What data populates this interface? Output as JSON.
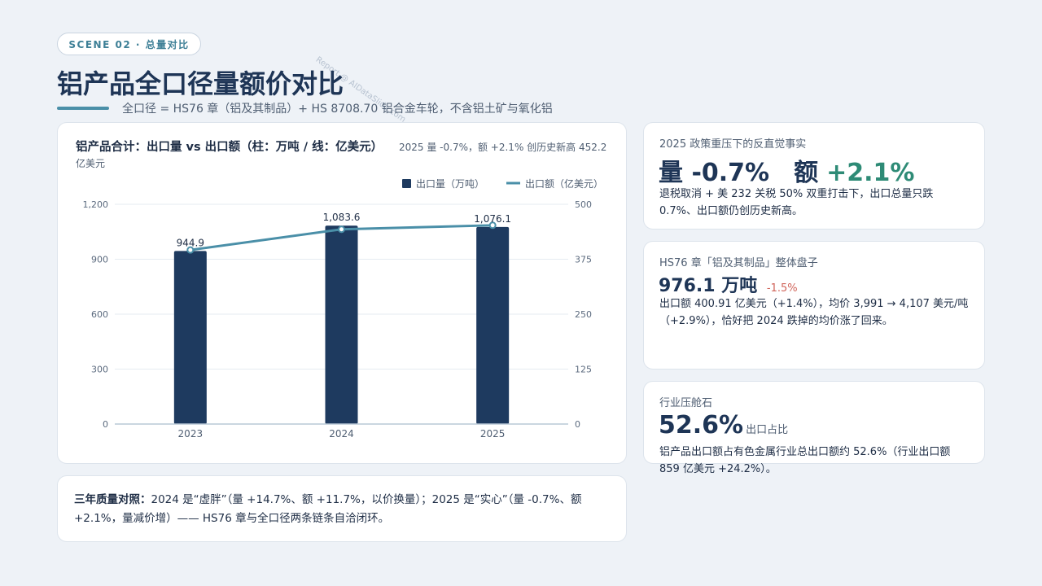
{
  "scene_tag": "SCENE 02 · 总量对比",
  "watermark": "Report @ AIDataSlide.com",
  "title": "铝产品全口径量额价对比",
  "subtitle": "全口径 = HS76 章（铝及其制品）+ HS 8708.70 铝合金车轮，不含铝土矿与氧化铝",
  "chart_data": {
    "type": "bar",
    "title": "铝产品合计：出口量 vs 出口额（柱：万吨 / 线：亿美元）",
    "subtitle": "2025 量 -0.7%，额 +2.1% 创历史新高 452.2 亿美元",
    "categories": [
      "2023",
      "2024",
      "2025"
    ],
    "series": [
      {
        "name": "出口量（万吨）",
        "type": "bar",
        "axis": "left",
        "values": [
          944.9,
          1083.6,
          1076.1
        ],
        "color": "#1e3a5f"
      },
      {
        "name": "出口额（亿美元）",
        "type": "line",
        "axis": "right",
        "values": [
          396.0,
          443.0,
          452.2
        ],
        "color": "#4a8fa8"
      }
    ],
    "data_labels": [
      "944.9",
      "1,083.6",
      "1,076.1"
    ],
    "y_left": {
      "ticks": [
        "0",
        "300",
        "600",
        "900",
        "1,200"
      ],
      "ylim": [
        0,
        1200
      ]
    },
    "y_right": {
      "ticks": [
        "0",
        "125",
        "250",
        "375",
        "500"
      ],
      "ylim": [
        0,
        500
      ]
    },
    "legend_position": "top-right",
    "grid": true
  },
  "note": {
    "label": "三年质量对照：",
    "text": "2024 是“虚胖”（量 +14.7%、额 +11.7%，以价换量）；2025 是“实心”（量 -0.7%、额 +2.1%，量减价增）—— HS76 章与全口径两条链条自洽闭环。"
  },
  "cards": [
    {
      "label": "2025 政策重压下的反直觉事实",
      "big1": "量 -0.7%",
      "big2": "额",
      "big3": "+2.1%",
      "desc": "退税取消 + 美 232 关税 50% 双重打击下，出口总量只跌 0.7%、出口额仍创历史新高。"
    },
    {
      "label": "HS76 章「铝及其制品」整体盘子",
      "big": "976.1 万吨",
      "delta": "-1.5%",
      "desc": "出口额 400.91 亿美元（+1.4%），均价 3,991 → 4,107 美元/吨（+2.9%），恰好把 2024 跌掉的均价涨了回来。"
    },
    {
      "label": "行业压舱石",
      "big": "52.6%",
      "unit": "出口占比",
      "desc": "铝产品出口额占有色金属行业总出口额约 52.6%（行业出口额 859 亿美元 +24.2%）。"
    }
  ],
  "colors": {
    "navy": "#1e3a5f",
    "teal": "#4a8fa8",
    "green": "#2e8b76",
    "red": "#d0645a"
  }
}
